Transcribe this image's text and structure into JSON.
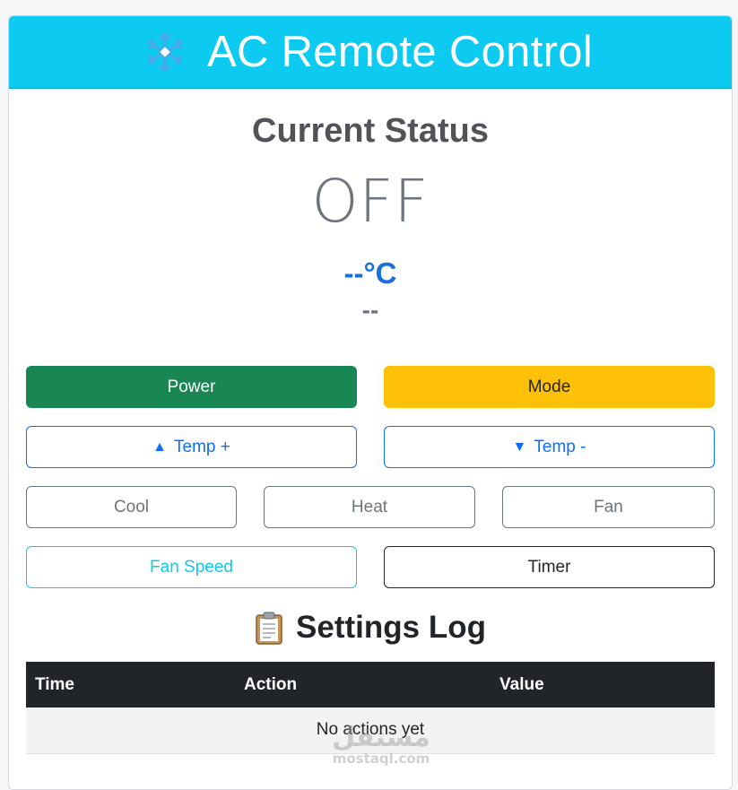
{
  "header": {
    "title": "AC Remote Control",
    "icon": "snowflake-icon"
  },
  "status": {
    "heading": "Current Status",
    "power": "OFF",
    "temperature": "--°C",
    "mode": "--"
  },
  "controls": {
    "power_label": "Power",
    "mode_label": "Mode",
    "temp_up_arrow": "▲",
    "temp_up_label": "Temp +",
    "temp_down_arrow": "▼",
    "temp_down_label": "Temp -",
    "cool_label": "Cool",
    "heat_label": "Heat",
    "fan_label": "Fan",
    "fan_speed_label": "Fan Speed",
    "timer_label": "Timer"
  },
  "log": {
    "icon": "clipboard-icon",
    "heading": "Settings Log",
    "columns": [
      "Time",
      "Action",
      "Value"
    ],
    "empty_message": "No actions yet"
  },
  "watermark": {
    "arabic": "مستقل",
    "latin": "mostaql.com"
  },
  "colors": {
    "header_bg": "#0dcaf0",
    "success": "#198754",
    "warning": "#ffc107",
    "primary": "#0d6efd",
    "secondary": "#6c757d",
    "info": "#0dcaf0",
    "dark": "#212529"
  }
}
